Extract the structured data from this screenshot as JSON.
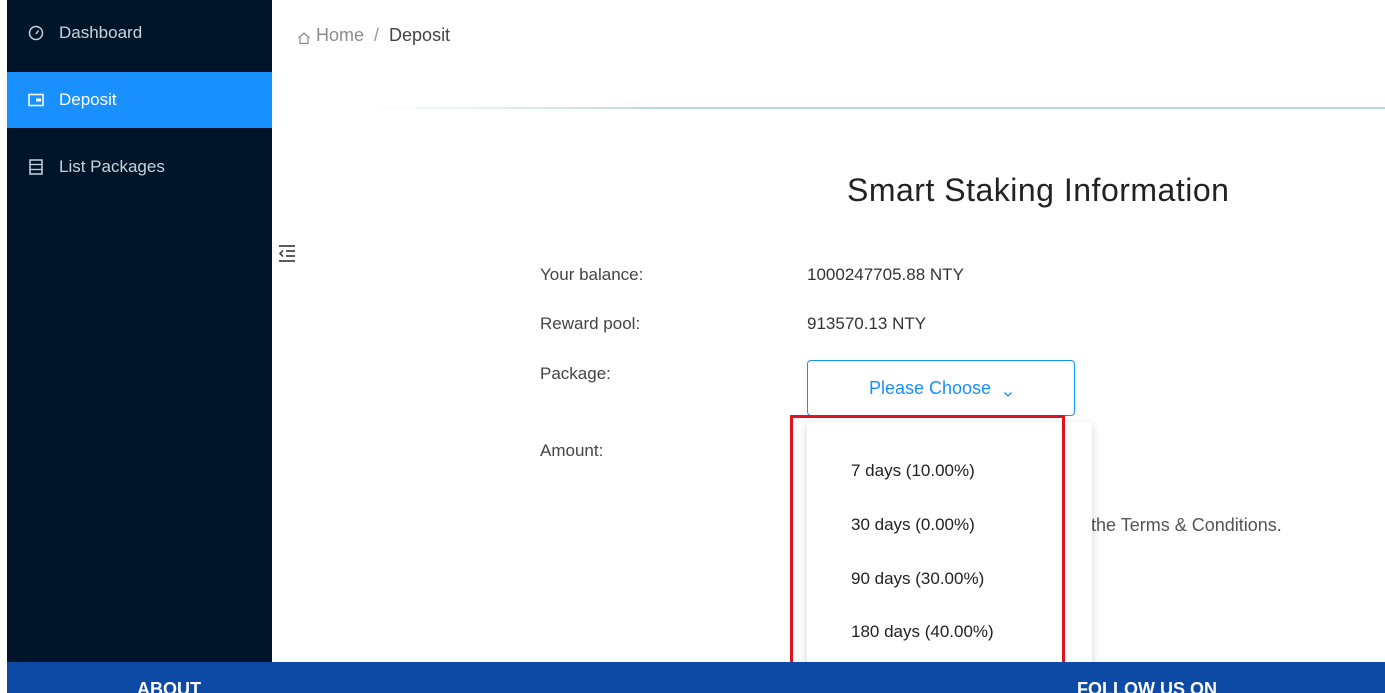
{
  "sidebar": {
    "items": [
      {
        "label": "Dashboard",
        "icon": "gauge-icon"
      },
      {
        "label": "Deposit",
        "icon": "wallet-icon",
        "active": true
      },
      {
        "label": "List Packages",
        "icon": "list-icon"
      }
    ]
  },
  "breadcrumb": {
    "home": "Home",
    "separator": "/",
    "current": "Deposit"
  },
  "page": {
    "title": "Smart Staking Information",
    "balance_label": "Your balance:",
    "balance_value": "1000247705.88 NTY",
    "reward_label": "Reward pool:",
    "reward_value": "913570.13 NTY",
    "package_label": "Package:",
    "package_placeholder": "Please Choose",
    "amount_label": "Amount:",
    "terms_text": "the Terms & Conditions."
  },
  "dropdown": {
    "options": [
      "7 days (10.00%)",
      "30 days (0.00%)",
      "90 days (30.00%)",
      "180 days (40.00%)"
    ]
  },
  "footer": {
    "about": "ABOUT",
    "follow": "FOLLOW US ON"
  },
  "colors": {
    "sidebar_bg": "#001529",
    "accent": "#1890ff",
    "highlight": "#e0141e",
    "footer_bg": "#0d4aa6"
  }
}
